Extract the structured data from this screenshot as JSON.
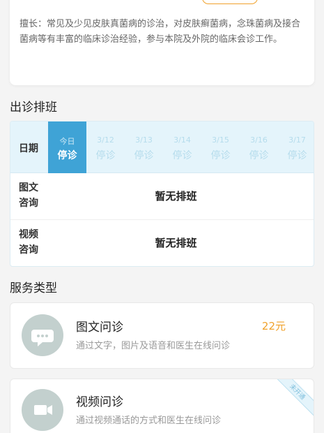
{
  "expertise": {
    "text": "擅长：常见及少见皮肤真菌病的诊治，对皮肤癣菌病，念珠菌病及接合菌病等有丰富的临床诊治经验，参与本院及外院的临床会诊工作。"
  },
  "schedule": {
    "title": "出诊排班",
    "date_label": "日期",
    "days": [
      {
        "date": "今日",
        "status": "停诊"
      },
      {
        "date": "3/12",
        "status": "停诊"
      },
      {
        "date": "3/13",
        "status": "停诊"
      },
      {
        "date": "3/14",
        "status": "停诊"
      },
      {
        "date": "3/15",
        "status": "停诊"
      },
      {
        "date": "3/16",
        "status": "停诊"
      },
      {
        "date": "3/17",
        "status": "停诊"
      }
    ],
    "rows": [
      {
        "label": "图文咨询",
        "empty": "暂无排班"
      },
      {
        "label": "视频咨询",
        "empty": "暂无排班"
      }
    ]
  },
  "services": {
    "title": "服务类型",
    "items": [
      {
        "name": "图文问诊",
        "desc": "通过文字，图片及语音和医生在线问诊",
        "price": "22元",
        "icon": "chat-icon"
      },
      {
        "name": "视频问诊",
        "desc": "通过视频通话的方式和医生在线问诊",
        "badge": "未开通",
        "icon": "video-camera-icon"
      }
    ]
  },
  "colors": {
    "accent": "#3fa3d6",
    "price": "#f0a12a",
    "icon_bg": "#c3d0ce"
  }
}
